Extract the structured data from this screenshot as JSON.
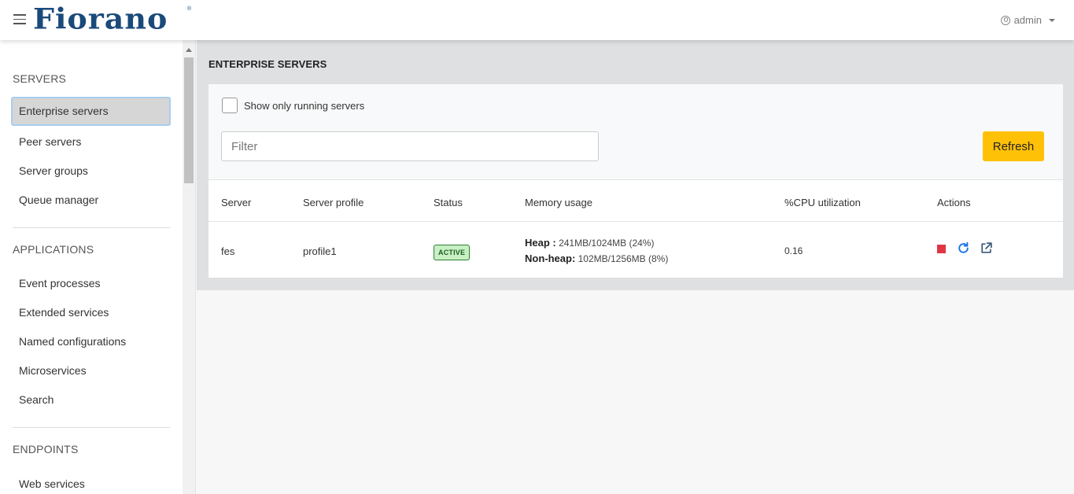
{
  "header": {
    "logo_text": "Fiorano",
    "logo_mark": "®",
    "user_label": "admin"
  },
  "sidebar": {
    "sections": [
      {
        "title": "SERVERS",
        "items": [
          "Enterprise servers",
          "Peer servers",
          "Server groups",
          "Queue manager"
        ]
      },
      {
        "title": "APPLICATIONS",
        "items": [
          "Event processes",
          "Extended services",
          "Named configurations",
          "Microservices",
          "Search"
        ]
      },
      {
        "title": "ENDPOINTS",
        "items": [
          "Web services"
        ]
      }
    ],
    "active_item": "Enterprise servers"
  },
  "main": {
    "title": "ENTERPRISE SERVERS",
    "show_running_label": "Show only running servers",
    "show_running_checked": false,
    "filter_placeholder": "Filter",
    "filter_value": "",
    "refresh_label": "Refresh",
    "table": {
      "columns": [
        "Server",
        "Server profile",
        "Status",
        "Memory usage",
        "%CPU utilization",
        "Actions"
      ],
      "rows": [
        {
          "server": "fes",
          "profile": "profile1",
          "status": "ACTIVE",
          "heap_label": "Heap :",
          "heap_value": "241MB/1024MB (24%)",
          "nonheap_label": "Non-heap:",
          "nonheap_value": "102MB/1256MB (8%)",
          "cpu": "0.16",
          "actions": [
            "stop-icon",
            "restart-icon",
            "external-link-icon"
          ]
        }
      ]
    }
  },
  "colors": {
    "brand": "#1a4a7a",
    "refresh_button": "#ffc107",
    "stop_icon": "#e03545",
    "restart_icon": "#1a73e8",
    "active_badge_bg": "#c8f0c4"
  }
}
